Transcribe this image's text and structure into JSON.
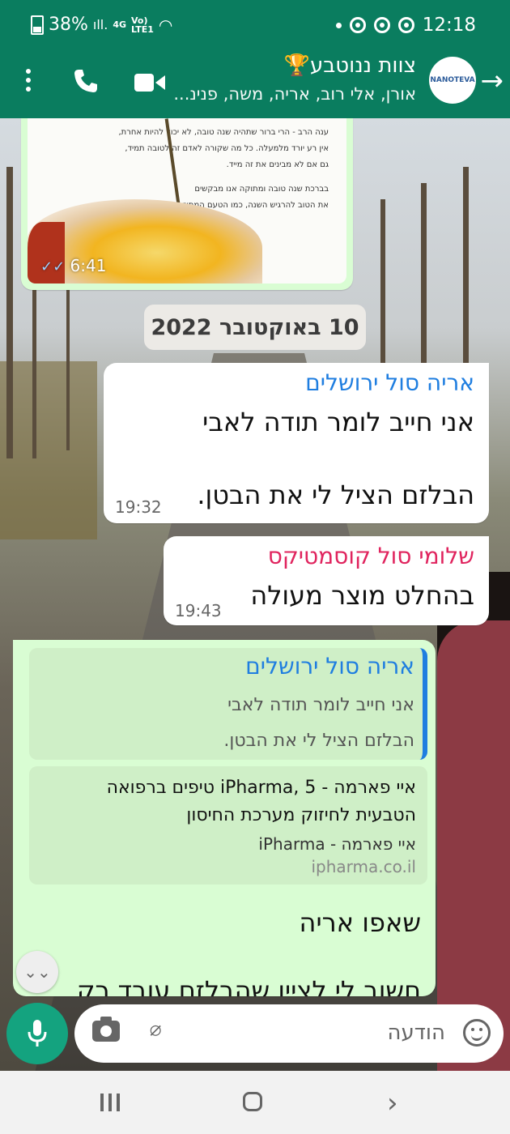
{
  "status_bar": {
    "battery": "38%",
    "network": "4G",
    "volte_top": "Vo)",
    "volte_bottom": "LTE1",
    "time": "12:18"
  },
  "header": {
    "title": "צוות ננוטבע🏆",
    "subtitle": "אורן, אלי רוב, אריה, משה, פנינ...",
    "avatar_text": "NANOTEVA"
  },
  "image_message": {
    "text_lines": [
      "ענה הרב - הרי ברור שתהיה שנה טובה, לא יכול להיות אחרת,",
      "אין רע יורד מלמעלה. כל מה שקורה לאדם זה לטובה תמיד,",
      "גם אם לא מבינים את זה מייד.",
      "",
      "בברכת שנה טובה ומתוקה אנו מבקשים",
      "את הטוב להרגיש השנה, כמו הטעם המתוק שמורגש מייד"
    ],
    "time": "6:41",
    "ticks": "✓✓"
  },
  "date_chip": "10 באוקטובר 2022",
  "messages": [
    {
      "sender": "אריה סול ירושלים",
      "sender_color": "#1f7ee0",
      "line1": "אני חייב לומר תודה לאבי",
      "line2": "הבלזם הציל לי את הבטן.",
      "time": "19:32"
    },
    {
      "sender": "שלומי סול קוסמטיקס",
      "sender_color": "#e0245e",
      "line1": "בהחלט מוצר מעולה",
      "time": "19:43"
    }
  ],
  "reply_message": {
    "quote": {
      "sender": "אריה סול ירושלים",
      "line1": "אני חייב לומר תודה לאבי",
      "line2": "הבלזם הציל לי את הבטן."
    },
    "link_preview": {
      "title_line1": "איי פארמה - iPharma, 5 טיפים ברפואה",
      "title_line2": "הטבעית לחיזוק מערכת החיסון",
      "site_name": "איי פארמה - iPharma",
      "url": "ipharma.co.il"
    },
    "body_line1": "שאפו אריה",
    "body_line2": "חשוב לי לציין שהבלזם עובד רק"
  },
  "composer": {
    "placeholder": "הודעה"
  },
  "icons": {
    "scroll_down": "⌄⌄",
    "back": "→"
  }
}
